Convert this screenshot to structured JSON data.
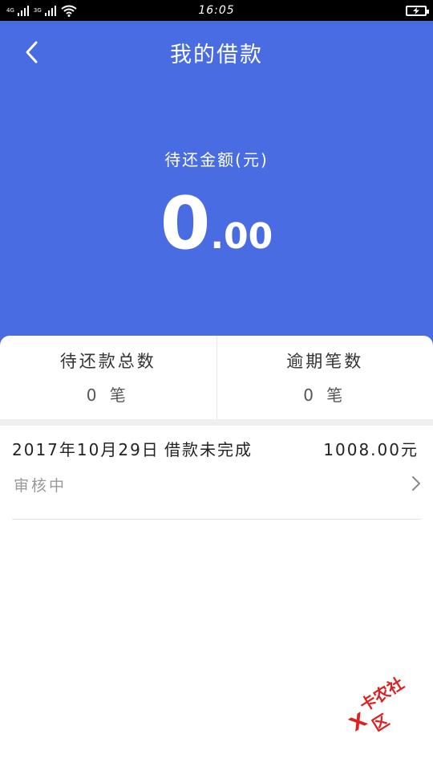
{
  "statusbar": {
    "net1": "4G",
    "net2": "3G",
    "time": "16:05"
  },
  "header": {
    "title": "我的借款",
    "amount_label": "待还金额(元)",
    "amount_int": "0",
    "amount_dec": ".00"
  },
  "stats": [
    {
      "label": "待还款总数",
      "value": "0 笔"
    },
    {
      "label": "逾期笔数",
      "value": "0 笔"
    }
  ],
  "record": {
    "date": "2017年10月29日",
    "status": "借款未完成",
    "amount": "1008.00元",
    "sub": "审核中"
  },
  "watermark": {
    "text": "卡农社区"
  },
  "colors": {
    "header_bg": "#4a6ce3",
    "watermark": "#e02020"
  }
}
